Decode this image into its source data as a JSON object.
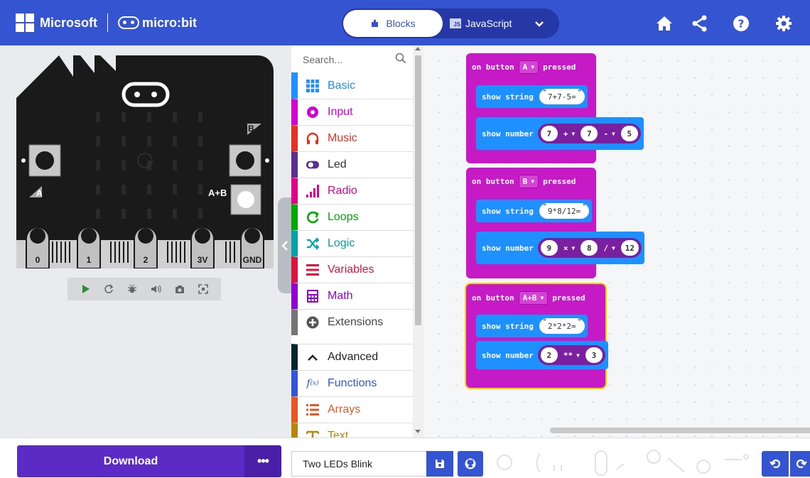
{
  "header": {
    "brand_microsoft": "Microsoft",
    "brand_microbit": "micro:bit",
    "mode_blocks": "Blocks",
    "mode_javascript": "JavaScript",
    "js_badge": "JS",
    "icons": [
      "home-icon",
      "share-icon",
      "help-icon",
      "settings-icon"
    ]
  },
  "simulator": {
    "pins": [
      "0",
      "1",
      "2",
      "3V",
      "GND"
    ],
    "button_a": "A",
    "button_b": "B",
    "button_ab": "A+B",
    "toolbar_icons": [
      "play-icon",
      "restart-icon",
      "debug-icon",
      "mute-icon",
      "screenshot-icon",
      "fullscreen-icon"
    ]
  },
  "toolbox": {
    "search_placeholder": "Search...",
    "categories": [
      {
        "label": "Basic",
        "color": "#1e90ff"
      },
      {
        "label": "Input",
        "color": "#d400d4"
      },
      {
        "label": "Music",
        "color": "#e63022"
      },
      {
        "label": "Led",
        "color": "#5c2d91"
      },
      {
        "label": "Radio",
        "color": "#e3008c"
      },
      {
        "label": "Loops",
        "color": "#00aa00"
      },
      {
        "label": "Logic",
        "color": "#00a4a6"
      },
      {
        "label": "Variables",
        "color": "#dc143c"
      },
      {
        "label": "Math",
        "color": "#9400d3"
      },
      {
        "label": "Extensions",
        "color": "#757575"
      },
      {
        "label": "Advanced",
        "color": "#00272b"
      },
      {
        "label": "Functions",
        "color": "#3455db"
      },
      {
        "label": "Arrays",
        "color": "#e65722"
      },
      {
        "label": "Text",
        "color": "#b8860b"
      }
    ]
  },
  "workspace": {
    "events": [
      {
        "on": "on button",
        "button": "A",
        "pressed": "pressed",
        "show_string": "show string",
        "string": "7+7-5=",
        "show_number": "show number",
        "n1": "7",
        "op1": "+",
        "n2": "7",
        "op2": "-",
        "n3": "5"
      },
      {
        "on": "on button",
        "button": "B",
        "pressed": "pressed",
        "show_string": "show string",
        "string": "9*8/12=",
        "show_number": "show number",
        "n1": "9",
        "op1": "×",
        "n2": "8",
        "op2": "/",
        "n3": "12"
      },
      {
        "on": "on button",
        "button": "A+B",
        "pressed": "pressed",
        "show_string": "show string",
        "string": "2*2*2=",
        "show_number": "show number",
        "n1": "2",
        "op1": "**",
        "n2": "3"
      }
    ]
  },
  "bottom": {
    "download": "Download",
    "more": "•••",
    "project_name": "Two LEDs Blink"
  },
  "colors": {
    "header": "#3454d1",
    "event_block": "#c61ac6",
    "basic_block": "#1e90ff",
    "math_expr": "#7a1fa0",
    "download": "#5c2bc6"
  }
}
